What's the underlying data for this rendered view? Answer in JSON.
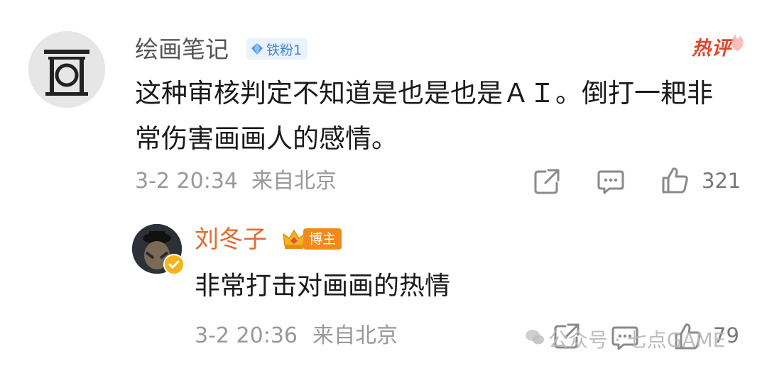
{
  "comment": {
    "username": "绘画笔记",
    "fan_badge": "铁粉1",
    "hot_label": "热评",
    "text_line1": "这种审核判定不知道是也是也是ＡＩ。倒打一耙非",
    "text_line2": "常伤害画画人的感情。",
    "time": "3-2 20:34",
    "location": "来自北京",
    "like_count": "321"
  },
  "reply": {
    "username": "刘冬子",
    "role_badge": "博主",
    "text": "非常打击对画画的热情",
    "time": "3-2 20:36",
    "location": "来自北京",
    "like_count": "79"
  },
  "watermark": {
    "text": "公众号 · 七点GAME"
  },
  "colors": {
    "username": "#555555",
    "hot": "#e2452b",
    "reply_name": "#e46a2d",
    "badge_blue": "#3a86d9",
    "badge_orange": "#f08a1d",
    "meta_gray": "#999999"
  }
}
